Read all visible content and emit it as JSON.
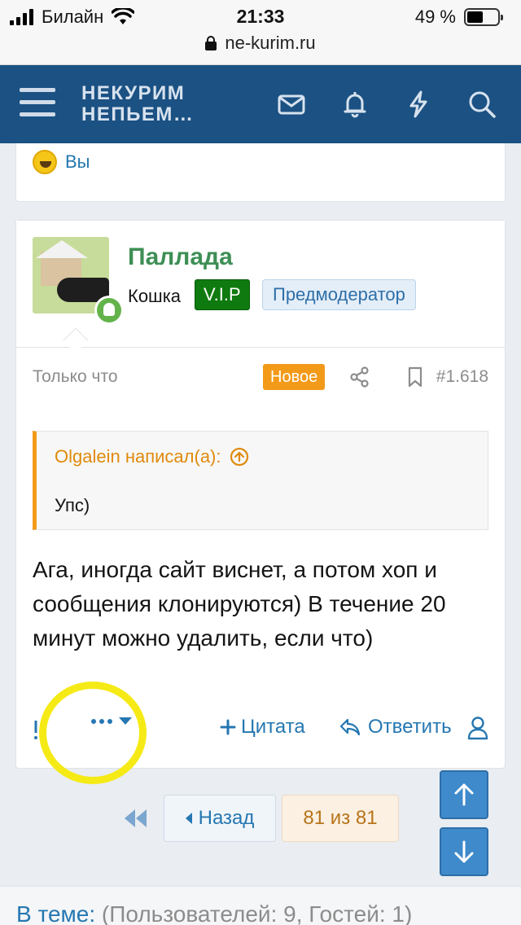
{
  "status_bar": {
    "carrier": "Билайн",
    "time": "21:33",
    "battery": "49 %",
    "battery_fill": 0.49,
    "url": "ne-kurim.ru"
  },
  "header": {
    "logo_line1": "НЕКУРИМ",
    "logo_line2": "НЕПЬЕМ…",
    "icons": [
      "menu-icon",
      "envelope-icon",
      "bell-icon",
      "lightning-icon",
      "search-icon"
    ]
  },
  "prev_post": {
    "reaction_user": "Вы"
  },
  "post": {
    "username": "Паллада",
    "user_title": "Кошка",
    "badges": [
      "V.I.P",
      "Предмодератор"
    ],
    "date": "Только что",
    "new_label": "Новое",
    "number": "#1.618",
    "quote_author": "Olgalein написал(а):",
    "quote_text": "Упс)",
    "message": "Ага, иногда сайт виснет, а потом хоп и сообщения клонируются) В течение 20 минут можно удалить, если что)",
    "actions": {
      "quote": "Цитата",
      "reply": "Ответить"
    }
  },
  "pagination": {
    "prev": "Назад",
    "current": "81 из 81"
  },
  "footer": {
    "in_thread": "В теме:",
    "stats": "(Пользователей: 9, Гостей: 1)"
  },
  "colors": {
    "header_bg": "#1b5183",
    "link": "#2577b1",
    "username": "#3e8f56",
    "vip": "#0f7a0f",
    "new_badge": "#f39a19",
    "highlight": "#f5ea15"
  }
}
